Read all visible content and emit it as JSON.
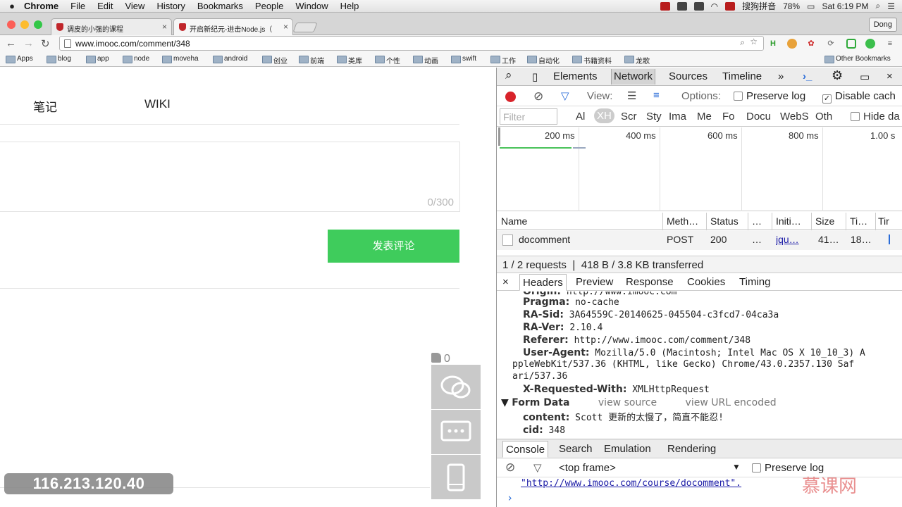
{
  "menubar": {
    "items": [
      "Chrome",
      "File",
      "Edit",
      "View",
      "History",
      "Bookmarks",
      "People",
      "Window",
      "Help"
    ],
    "input_method": "搜狗拼音",
    "battery": "78%",
    "clock": "Sat 6:19 PM"
  },
  "tabs": [
    {
      "label": "调皮的小强的课程",
      "close": "×"
    },
    {
      "label": "开启新纪元-进击Node.js（",
      "close": "×"
    }
  ],
  "profile": "Dong",
  "toolbar": {
    "back": "←",
    "forward": "→",
    "reload": "↻",
    "url": "www.imooc.com/comment/348"
  },
  "bookmarks": [
    "Apps",
    "blog",
    "app",
    "node",
    "moveha",
    "android",
    "创业",
    "前端",
    "类库",
    "个性",
    "动画",
    "swift",
    "工作",
    "自动化",
    "书籍资料",
    "龙歌",
    "Other Bookmarks"
  ],
  "page": {
    "nav": [
      "笔记",
      "WIKI"
    ],
    "counter": "0/300",
    "submit": "发表评论",
    "like_count": "0",
    "ip": "116.213.120.40"
  },
  "devtools": {
    "tabs": [
      "Elements",
      "Network",
      "Sources",
      "Timeline",
      "»"
    ],
    "view_label": "View:",
    "options_label": "Options:",
    "preserve_log": "Preserve log",
    "disable_cache": "Disable cach",
    "filter_placeholder": "Filter",
    "filter_types": [
      "Al",
      "XH",
      "Scr",
      "Sty",
      "Ima",
      "Me",
      "Fo",
      "Docu",
      "WebS",
      "Oth"
    ],
    "hide_data": "Hide da",
    "ticks": [
      "200 ms",
      "400 ms",
      "600 ms",
      "800 ms",
      "1.00 s"
    ],
    "columns": [
      "Name",
      "Meth…",
      "Status",
      "…",
      "Initi…",
      "Size",
      "Ti…",
      "Tir"
    ],
    "row": {
      "name": "docomment",
      "method": "POST",
      "status": "200",
      "dots": "…",
      "initiator": "jqu…",
      "size": "41…",
      "time": "18…"
    },
    "summary": "1 / 2 requests ❘ 418 B / 3.8 KB transferred",
    "detail_tabs": [
      "Headers",
      "Preview",
      "Response",
      "Cookies",
      "Timing"
    ],
    "headers": [
      {
        "key": "Origin:",
        "value": "http://www.imooc.com"
      },
      {
        "key": "Pragma:",
        "value": "no-cache"
      },
      {
        "key": "RA-Sid:",
        "value": "3A64559C-20140625-045504-c3fcd7-04ca3a"
      },
      {
        "key": "RA-Ver:",
        "value": "2.10.4"
      },
      {
        "key": "Referer:",
        "value": "http://www.imooc.com/comment/348"
      },
      {
        "key": "User-Agent:",
        "value": "Mozilla/5.0 (Macintosh; Intel Mac OS X 10_10_3) A"
      }
    ],
    "ua_line2": "ppleWebKit/537.36 (KHTML, like Gecko) Chrome/43.0.2357.130 Saf",
    "ua_line3": "ari/537.36",
    "x_requested": {
      "key": "X-Requested-With:",
      "value": "XMLHttpRequest"
    },
    "form_data": {
      "title": "Form Data",
      "view_source": "view source",
      "view_url": "view URL encoded"
    },
    "form_fields": [
      {
        "key": "content:",
        "value": "Scott 更新的太慢了，简直不能忍!"
      },
      {
        "key": "cid:",
        "value": "348"
      }
    ],
    "console_tabs": [
      "Console",
      "Search",
      "Emulation",
      "Rendering"
    ],
    "frame": "<top frame>",
    "console_preserve": "Preserve log",
    "console_line": "\"http://www.imooc.com/course/docomment\".",
    "prompt": "›"
  },
  "watermark": "慕课网"
}
